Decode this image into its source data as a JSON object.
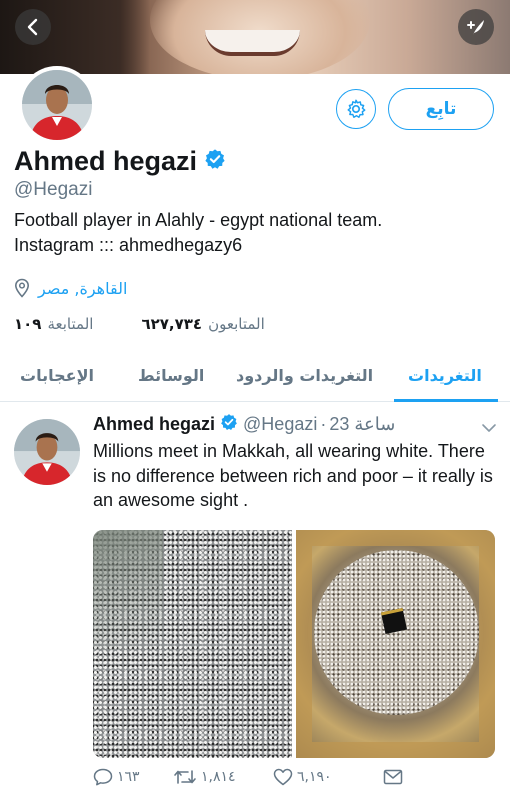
{
  "header": {
    "back_icon": "chevron-left-icon",
    "compose_icon": "compose-tweet-icon"
  },
  "profile": {
    "follow_label": "تابِع",
    "settings_icon": "gear-icon",
    "name": "Ahmed hegazi",
    "handle": "@Hegazi",
    "bio_line1": "Football player in Alahly - egypt national team.",
    "bio_line2": "Instagram ::: ahmedhegazy6",
    "location": "القاهرة, مصر",
    "followers_count": "٦٢٧,٧٣٤",
    "followers_label": "المتابعون",
    "following_count": "١٠٩",
    "following_label": "المتابعة"
  },
  "tabs": [
    {
      "label": "التغريدات",
      "active": true
    },
    {
      "label": "التغريدات والردود",
      "active": false
    },
    {
      "label": "الوسائط",
      "active": false
    },
    {
      "label": "الإعجابات",
      "active": false
    }
  ],
  "tweet": {
    "name": "Ahmed hegazi",
    "handle": "@Hegazi",
    "separator": "·",
    "time": "23 ساعة",
    "text": "Millions meet in Makkah, all wearing white. There is no difference between rich and poor – it really is an awesome sight .",
    "replies": "١٦٣",
    "retweets": "١,٨١٤",
    "likes": "٦,١٩٠"
  },
  "colors": {
    "accent": "#1da1f2",
    "text": "#14171a",
    "muted": "#657786"
  }
}
